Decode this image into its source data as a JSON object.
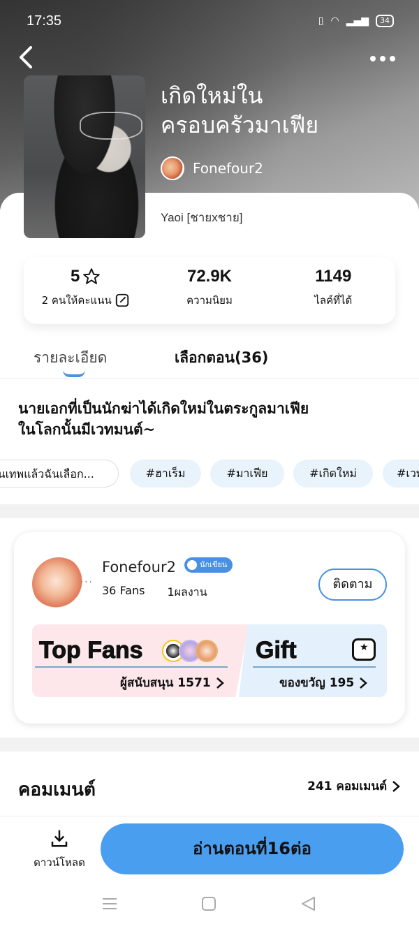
{
  "status": {
    "time": "17:35",
    "battery": "34"
  },
  "book": {
    "title_line1": "เกิดใหม่ใน",
    "title_line2": "ครอบครัวมาเฟีย",
    "author": "Fonefour2",
    "genre": "Yaoi [ชายxชาย]"
  },
  "stats": {
    "rating": "5",
    "rating_label": "2 คนให้คะแนน",
    "popularity": "72.9K",
    "popularity_label": "ความนิยม",
    "likes": "1149",
    "likes_label": "ไลค์ที่ได้"
  },
  "tabs": {
    "details": "รายละเอียด",
    "episodes": "เลือกตอน(36)"
  },
  "description": {
    "line1": "นายเอกที่เป็นนักฆ่าได้เกิดใหม่ในตระกูลมาเฟีย",
    "line2": "ในโลกนั้นมีเวทมนต์~"
  },
  "tags": [
    "เป็นเทพแล้วฉันเลือก...",
    "#ฮาเร็ม",
    "#มาเฟีย",
    "#เกิดใหม่",
    "#เวท"
  ],
  "author_card": {
    "name": "Fonefour2",
    "badge": "นักเขียน",
    "fans": "36 Fans",
    "works": "1ผลงาน",
    "follow": "ติดตาม",
    "top_fans_title": "Top Fans",
    "top_fans_sub": "ผู้สนับสนุน 1571",
    "gift_title": "Gift",
    "gift_sub": "ของขวัญ 195"
  },
  "comments": {
    "heading": "คอมเมนต์",
    "count": "241 คอมเมนต์"
  },
  "bottom": {
    "download": "ดาวน์โหลด",
    "read": "อ่านตอนที่16ต่อ"
  },
  "colors": {
    "accent": "#4a9ef0",
    "tag_bg": "#e9f3fb",
    "fans_bg": "#fde7ea",
    "gift_bg": "#e4f0fb"
  }
}
